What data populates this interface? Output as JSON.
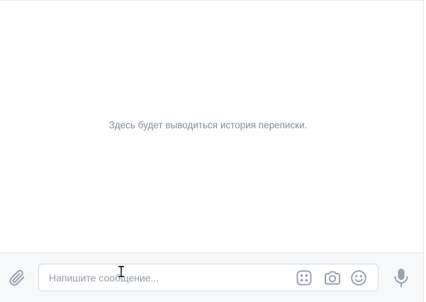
{
  "history": {
    "empty_text": "Здесь будет выводиться история переписки."
  },
  "composer": {
    "message_placeholder": "Напишите сообщение...",
    "message_value": ""
  },
  "icons": {
    "attach": "paperclip-icon",
    "stickers": "sticker-icon",
    "camera": "camera-icon",
    "emoji": "smiley-icon",
    "voice": "microphone-icon"
  },
  "colors": {
    "icon": "#99a2ad",
    "placeholder": "#939ca6",
    "empty_text": "#818c99",
    "border": "#e7e8ec"
  }
}
